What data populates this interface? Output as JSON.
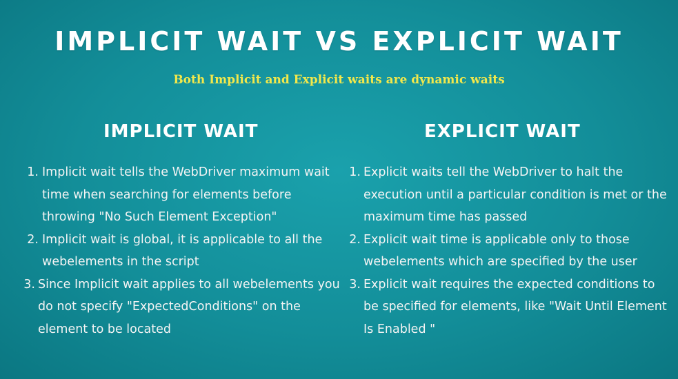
{
  "title": "IMPLICIT WAIT VS EXPLICIT WAIT",
  "subtitle": "Both Implicit and Explicit waits are dynamic waits",
  "implicit": {
    "heading": "IMPLICIT WAIT",
    "items": [
      {
        "num": "1.",
        "text": "Implicit wait tells the WebDriver maximum wait time when searching for elements before throwing \"No Such Element Exception\""
      },
      {
        "num": "2.",
        "text": "Implicit wait is global, it is applicable to all the webelements in the script"
      },
      {
        "num": "3.",
        "text": "Since Implicit wait applies to all webelements you do not specify \"ExpectedConditions\" on the element to be located"
      }
    ]
  },
  "explicit": {
    "heading": "EXPLICIT WAIT",
    "items": [
      {
        "num": "1.",
        "text": "Explicit waits tell the WebDriver to halt the execution until a particular condition is met or the maximum time has passed"
      },
      {
        "num": "2.",
        "text": "Explicit wait time is applicable only to those webelements which are specified by the user"
      },
      {
        "num": "3.",
        "text": "Explicit wait requires the expected conditions to be specified for elements, like \"Wait Until Element Is Enabled \""
      }
    ]
  },
  "colors": {
    "background": "#138e99",
    "title": "#ffffff",
    "subtitle": "#f2e84b",
    "body_text": "#f4f4f4"
  }
}
